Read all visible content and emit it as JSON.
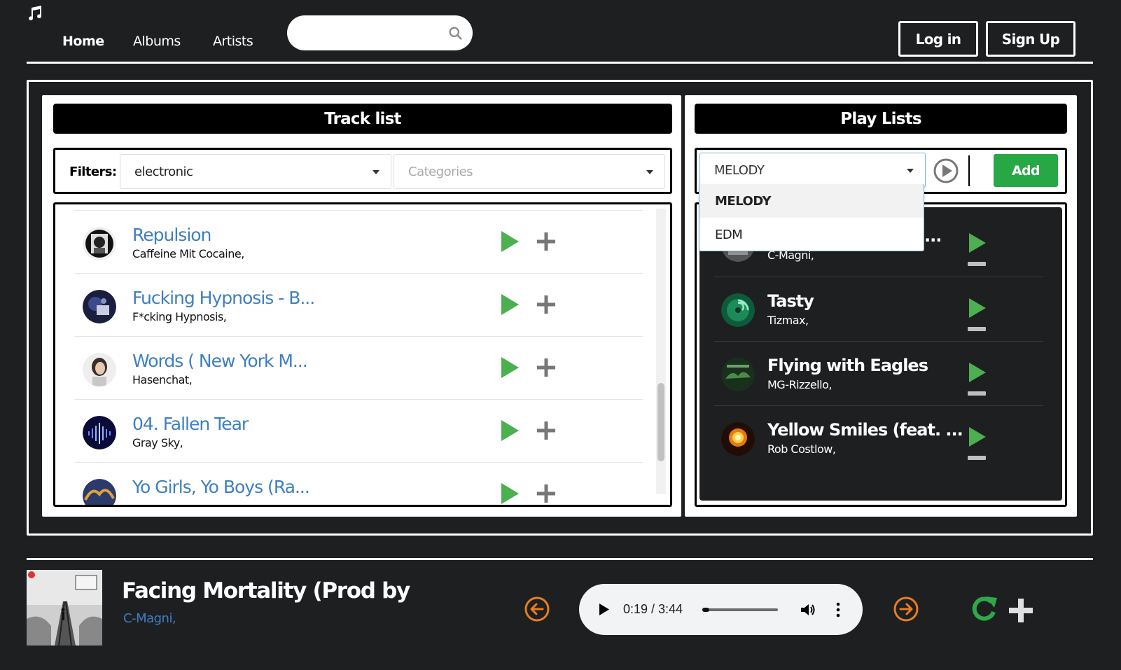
{
  "nav": {
    "home": "Home",
    "albums": "Albums",
    "artists": "Artists",
    "search_placeholder": "",
    "login": "Log in",
    "signup": "Sign Up"
  },
  "tracklist": {
    "title": "Track list",
    "filters_label": "Filters:",
    "genre_value": "electronic",
    "categories_placeholder": "Categories",
    "items": [
      {
        "title": "Repulsion",
        "artist": "Caffeine Mit Cocaine,"
      },
      {
        "title": "Fucking Hypnosis - B...",
        "artist": "F*cking Hypnosis,"
      },
      {
        "title": "Words ( New York M...",
        "artist": "Hasenchat,"
      },
      {
        "title": "04. Fallen Tear",
        "artist": "Gray Sky,"
      },
      {
        "title": "Yo Girls, Yo Boys (Ra...",
        "artist": ""
      }
    ]
  },
  "playlists": {
    "title": "Play Lists",
    "selected": "MELODY",
    "add_label": "Add",
    "options": [
      "MELODY",
      "EDM"
    ],
    "items": [
      {
        "title": "...",
        "artist": "C-Magni,"
      },
      {
        "title": "Tasty",
        "artist": "Tizmax,"
      },
      {
        "title": "Flying with Eagles",
        "artist": "MG-Rizzello,"
      },
      {
        "title": "Yellow Smiles (feat. ...",
        "artist": "Rob Costlow,"
      }
    ]
  },
  "player": {
    "title": "Facing Mortality (Prod by",
    "artist": "C-Magni,",
    "time": "0:19 / 3:44",
    "progress": 0.09
  },
  "colors": {
    "background": "#1e1f21",
    "accent_green": "#4caf50",
    "link_blue": "#3d7fc1",
    "nav_orange": "#e67e22",
    "add_button": "#28a745"
  }
}
